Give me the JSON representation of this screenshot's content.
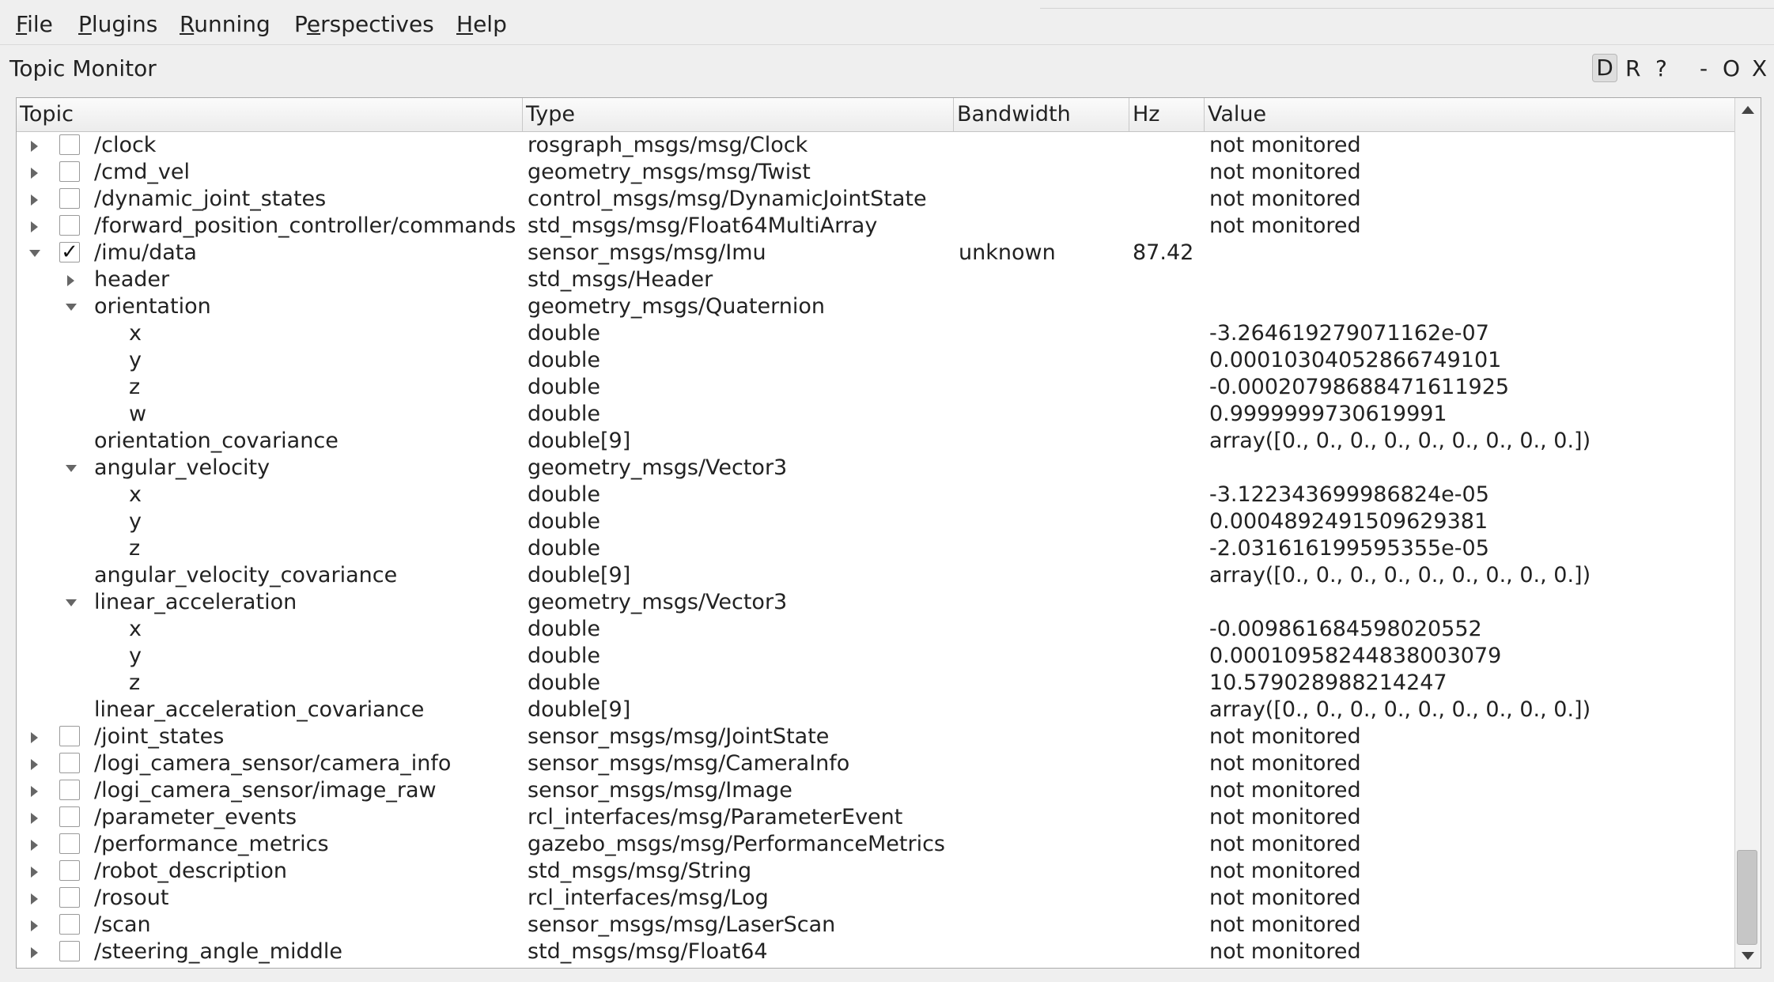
{
  "menu": [
    {
      "label": "File",
      "mnemonic": "F"
    },
    {
      "label": "Plugins",
      "mnemonic": "P"
    },
    {
      "label": "Running",
      "mnemonic": "R"
    },
    {
      "label": "Perspectives",
      "mnemonic": "e"
    },
    {
      "label": "Help",
      "mnemonic": "H"
    }
  ],
  "plugin": {
    "title": "Topic Monitor",
    "controls": {
      "d": "D",
      "r": "R",
      "help": "?",
      "minimize": "-",
      "float": "O",
      "close": "X"
    }
  },
  "columns": {
    "topic": "Topic",
    "type": "Type",
    "bandwidth": "Bandwidth",
    "hz": "Hz",
    "value": "Value"
  },
  "rows": [
    {
      "name": "/clock",
      "type": "rosgraph_msgs/msg/Clock",
      "bandwidth": "",
      "hz": "",
      "value": "not monitored",
      "level": 0,
      "expander": "right",
      "checkbox": true,
      "checked": false
    },
    {
      "name": "/cmd_vel",
      "type": "geometry_msgs/msg/Twist",
      "bandwidth": "",
      "hz": "",
      "value": "not monitored",
      "level": 0,
      "expander": "right",
      "checkbox": true,
      "checked": false
    },
    {
      "name": "/dynamic_joint_states",
      "type": "control_msgs/msg/DynamicJointState",
      "bandwidth": "",
      "hz": "",
      "value": "not monitored",
      "level": 0,
      "expander": "right",
      "checkbox": true,
      "checked": false
    },
    {
      "name": "/forward_position_controller/commands",
      "type": "std_msgs/msg/Float64MultiArray",
      "bandwidth": "",
      "hz": "",
      "value": "not monitored",
      "level": 0,
      "expander": "right",
      "checkbox": true,
      "checked": false
    },
    {
      "name": "/imu/data",
      "type": "sensor_msgs/msg/Imu",
      "bandwidth": "unknown",
      "hz": "87.42",
      "value": "",
      "level": 0,
      "expander": "down",
      "checkbox": true,
      "checked": true
    },
    {
      "name": "header",
      "type": "std_msgs/Header",
      "bandwidth": "",
      "hz": "",
      "value": "",
      "level": 1,
      "expander": "right",
      "checkbox": false,
      "checked": false
    },
    {
      "name": "orientation",
      "type": "geometry_msgs/Quaternion",
      "bandwidth": "",
      "hz": "",
      "value": "",
      "level": 1,
      "expander": "down",
      "checkbox": false,
      "checked": false
    },
    {
      "name": "x",
      "type": "double",
      "bandwidth": "",
      "hz": "",
      "value": "-3.264619279071162e-07",
      "level": 2,
      "expander": "none",
      "checkbox": false,
      "checked": false
    },
    {
      "name": "y",
      "type": "double",
      "bandwidth": "",
      "hz": "",
      "value": "0.00010304052866749101",
      "level": 2,
      "expander": "none",
      "checkbox": false,
      "checked": false
    },
    {
      "name": "z",
      "type": "double",
      "bandwidth": "",
      "hz": "",
      "value": "-0.00020798688471611925",
      "level": 2,
      "expander": "none",
      "checkbox": false,
      "checked": false
    },
    {
      "name": "w",
      "type": "double",
      "bandwidth": "",
      "hz": "",
      "value": "0.9999999730619991",
      "level": 2,
      "expander": "none",
      "checkbox": false,
      "checked": false
    },
    {
      "name": "orientation_covariance",
      "type": "double[9]",
      "bandwidth": "",
      "hz": "",
      "value": "array([0., 0., 0., 0., 0., 0., 0., 0., 0.])",
      "level": 1,
      "expander": "none",
      "checkbox": false,
      "checked": false
    },
    {
      "name": "angular_velocity",
      "type": "geometry_msgs/Vector3",
      "bandwidth": "",
      "hz": "",
      "value": "",
      "level": 1,
      "expander": "down",
      "checkbox": false,
      "checked": false
    },
    {
      "name": "x",
      "type": "double",
      "bandwidth": "",
      "hz": "",
      "value": "-3.122343699986824e-05",
      "level": 2,
      "expander": "none",
      "checkbox": false,
      "checked": false
    },
    {
      "name": "y",
      "type": "double",
      "bandwidth": "",
      "hz": "",
      "value": "0.0004892491509629381",
      "level": 2,
      "expander": "none",
      "checkbox": false,
      "checked": false
    },
    {
      "name": "z",
      "type": "double",
      "bandwidth": "",
      "hz": "",
      "value": "-2.031616199595355e-05",
      "level": 2,
      "expander": "none",
      "checkbox": false,
      "checked": false
    },
    {
      "name": "angular_velocity_covariance",
      "type": "double[9]",
      "bandwidth": "",
      "hz": "",
      "value": "array([0., 0., 0., 0., 0., 0., 0., 0., 0.])",
      "level": 1,
      "expander": "none",
      "checkbox": false,
      "checked": false
    },
    {
      "name": "linear_acceleration",
      "type": "geometry_msgs/Vector3",
      "bandwidth": "",
      "hz": "",
      "value": "",
      "level": 1,
      "expander": "down",
      "checkbox": false,
      "checked": false
    },
    {
      "name": "x",
      "type": "double",
      "bandwidth": "",
      "hz": "",
      "value": "-0.009861684598020552",
      "level": 2,
      "expander": "none",
      "checkbox": false,
      "checked": false
    },
    {
      "name": "y",
      "type": "double",
      "bandwidth": "",
      "hz": "",
      "value": "0.00010958244838003079",
      "level": 2,
      "expander": "none",
      "checkbox": false,
      "checked": false
    },
    {
      "name": "z",
      "type": "double",
      "bandwidth": "",
      "hz": "",
      "value": "10.579028988214247",
      "level": 2,
      "expander": "none",
      "checkbox": false,
      "checked": false
    },
    {
      "name": "linear_acceleration_covariance",
      "type": "double[9]",
      "bandwidth": "",
      "hz": "",
      "value": "array([0., 0., 0., 0., 0., 0., 0., 0., 0.])",
      "level": 1,
      "expander": "none",
      "checkbox": false,
      "checked": false
    },
    {
      "name": "/joint_states",
      "type": "sensor_msgs/msg/JointState",
      "bandwidth": "",
      "hz": "",
      "value": "not monitored",
      "level": 0,
      "expander": "right",
      "checkbox": true,
      "checked": false
    },
    {
      "name": "/logi_camera_sensor/camera_info",
      "type": "sensor_msgs/msg/CameraInfo",
      "bandwidth": "",
      "hz": "",
      "value": "not monitored",
      "level": 0,
      "expander": "right",
      "checkbox": true,
      "checked": false
    },
    {
      "name": "/logi_camera_sensor/image_raw",
      "type": "sensor_msgs/msg/Image",
      "bandwidth": "",
      "hz": "",
      "value": "not monitored",
      "level": 0,
      "expander": "right",
      "checkbox": true,
      "checked": false
    },
    {
      "name": "/parameter_events",
      "type": "rcl_interfaces/msg/ParameterEvent",
      "bandwidth": "",
      "hz": "",
      "value": "not monitored",
      "level": 0,
      "expander": "right",
      "checkbox": true,
      "checked": false
    },
    {
      "name": "/performance_metrics",
      "type": "gazebo_msgs/msg/PerformanceMetrics",
      "bandwidth": "",
      "hz": "",
      "value": "not monitored",
      "level": 0,
      "expander": "right",
      "checkbox": true,
      "checked": false
    },
    {
      "name": "/robot_description",
      "type": "std_msgs/msg/String",
      "bandwidth": "",
      "hz": "",
      "value": "not monitored",
      "level": 0,
      "expander": "right",
      "checkbox": true,
      "checked": false
    },
    {
      "name": "/rosout",
      "type": "rcl_interfaces/msg/Log",
      "bandwidth": "",
      "hz": "",
      "value": "not monitored",
      "level": 0,
      "expander": "right",
      "checkbox": true,
      "checked": false
    },
    {
      "name": "/scan",
      "type": "sensor_msgs/msg/LaserScan",
      "bandwidth": "",
      "hz": "",
      "value": "not monitored",
      "level": 0,
      "expander": "right",
      "checkbox": true,
      "checked": false
    },
    {
      "name": "/steering_angle_middle",
      "type": "std_msgs/msg/Float64",
      "bandwidth": "",
      "hz": "",
      "value": "not monitored",
      "level": 0,
      "expander": "right",
      "checkbox": true,
      "checked": false
    }
  ],
  "scrollbar": {
    "position_fraction": 1.0
  }
}
